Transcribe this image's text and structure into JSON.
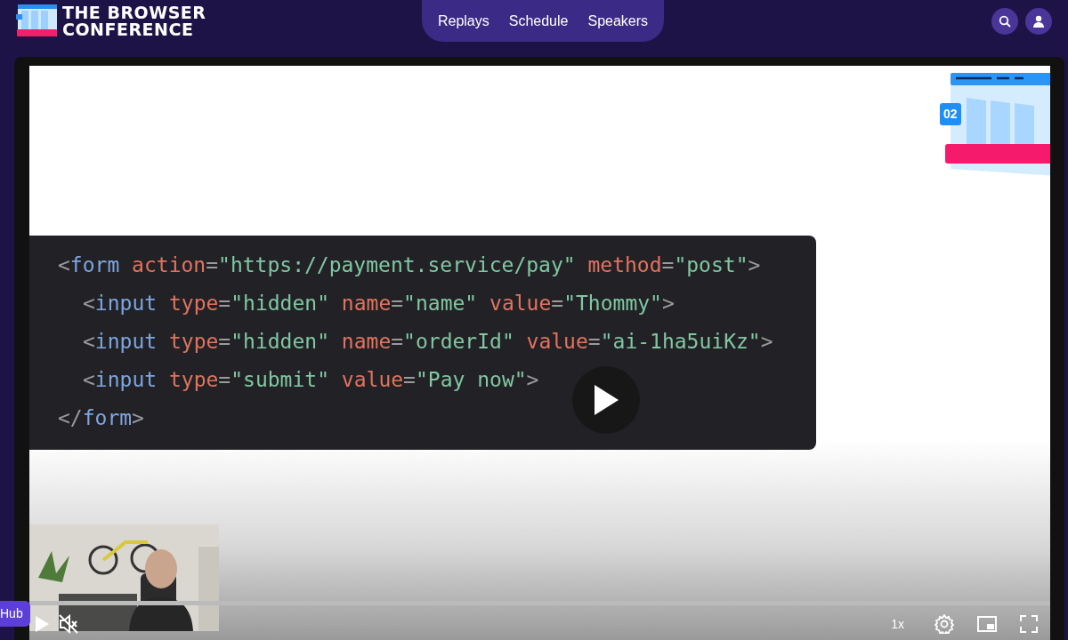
{
  "header": {
    "logo": {
      "line_1": "THE BROWSER",
      "line_2": "CONFERENCE"
    },
    "nav": [
      {
        "label": "Replays"
      },
      {
        "label": "Schedule"
      },
      {
        "label": "Speakers"
      }
    ]
  },
  "player": {
    "slide": {
      "badge": "02",
      "code": [
        {
          "tokens": [
            {
              "kind": "punct",
              "text": "<"
            },
            {
              "kind": "tag",
              "text": "form"
            },
            {
              "kind": "attr",
              "text": " action"
            },
            {
              "kind": "punct",
              "text": "="
            },
            {
              "kind": "string",
              "text": "\"https://payment.service/pay\""
            },
            {
              "kind": "attr",
              "text": " method"
            },
            {
              "kind": "punct",
              "text": "="
            },
            {
              "kind": "string",
              "text": "\"post\""
            },
            {
              "kind": "punct",
              "text": ">"
            }
          ],
          "children": [
            {
              "tokens": [
                {
                  "kind": "punct",
                  "text": "<"
                },
                {
                  "kind": "tag",
                  "text": "input"
                },
                {
                  "kind": "attr",
                  "text": " type"
                },
                {
                  "kind": "punct",
                  "text": "="
                },
                {
                  "kind": "string",
                  "text": "\"hidden\""
                },
                {
                  "kind": "attr",
                  "text": " name"
                },
                {
                  "kind": "punct",
                  "text": "="
                },
                {
                  "kind": "string",
                  "text": "\"name\""
                },
                {
                  "kind": "attr",
                  "text": " value"
                },
                {
                  "kind": "punct",
                  "text": "="
                },
                {
                  "kind": "string",
                  "text": "\"Thommy\""
                },
                {
                  "kind": "punct",
                  "text": ">"
                }
              ]
            },
            {
              "tokens": [
                {
                  "kind": "punct",
                  "text": "<"
                },
                {
                  "kind": "tag",
                  "text": "input"
                },
                {
                  "kind": "attr",
                  "text": " type"
                },
                {
                  "kind": "punct",
                  "text": "="
                },
                {
                  "kind": "string",
                  "text": "\"hidden\""
                },
                {
                  "kind": "attr",
                  "text": " name"
                },
                {
                  "kind": "punct",
                  "text": "="
                },
                {
                  "kind": "string",
                  "text": "\"orderId\""
                },
                {
                  "kind": "attr",
                  "text": " value"
                },
                {
                  "kind": "punct",
                  "text": "="
                },
                {
                  "kind": "string",
                  "text": "\"ai-1ha5uiKz\""
                },
                {
                  "kind": "punct",
                  "text": ">"
                }
              ]
            },
            {
              "tokens": [
                {
                  "kind": "punct",
                  "text": "<"
                },
                {
                  "kind": "tag",
                  "text": "input"
                },
                {
                  "kind": "attr",
                  "text": " type"
                },
                {
                  "kind": "punct",
                  "text": "="
                },
                {
                  "kind": "string",
                  "text": "\"submit\""
                },
                {
                  "kind": "attr",
                  "text": " value"
                },
                {
                  "kind": "punct",
                  "text": "="
                },
                {
                  "kind": "string",
                  "text": "\"Pay now\""
                },
                {
                  "kind": "punct",
                  "text": ">"
                }
              ]
            }
          ]
        },
        {
          "tokens": [
            {
              "kind": "punct",
              "text": "</"
            },
            {
              "kind": "tag",
              "text": "form"
            },
            {
              "kind": "punct",
              "text": ">"
            }
          ]
        }
      ]
    },
    "muted": true,
    "speed": "1x"
  },
  "hub_button": {
    "label": "Hub"
  }
}
